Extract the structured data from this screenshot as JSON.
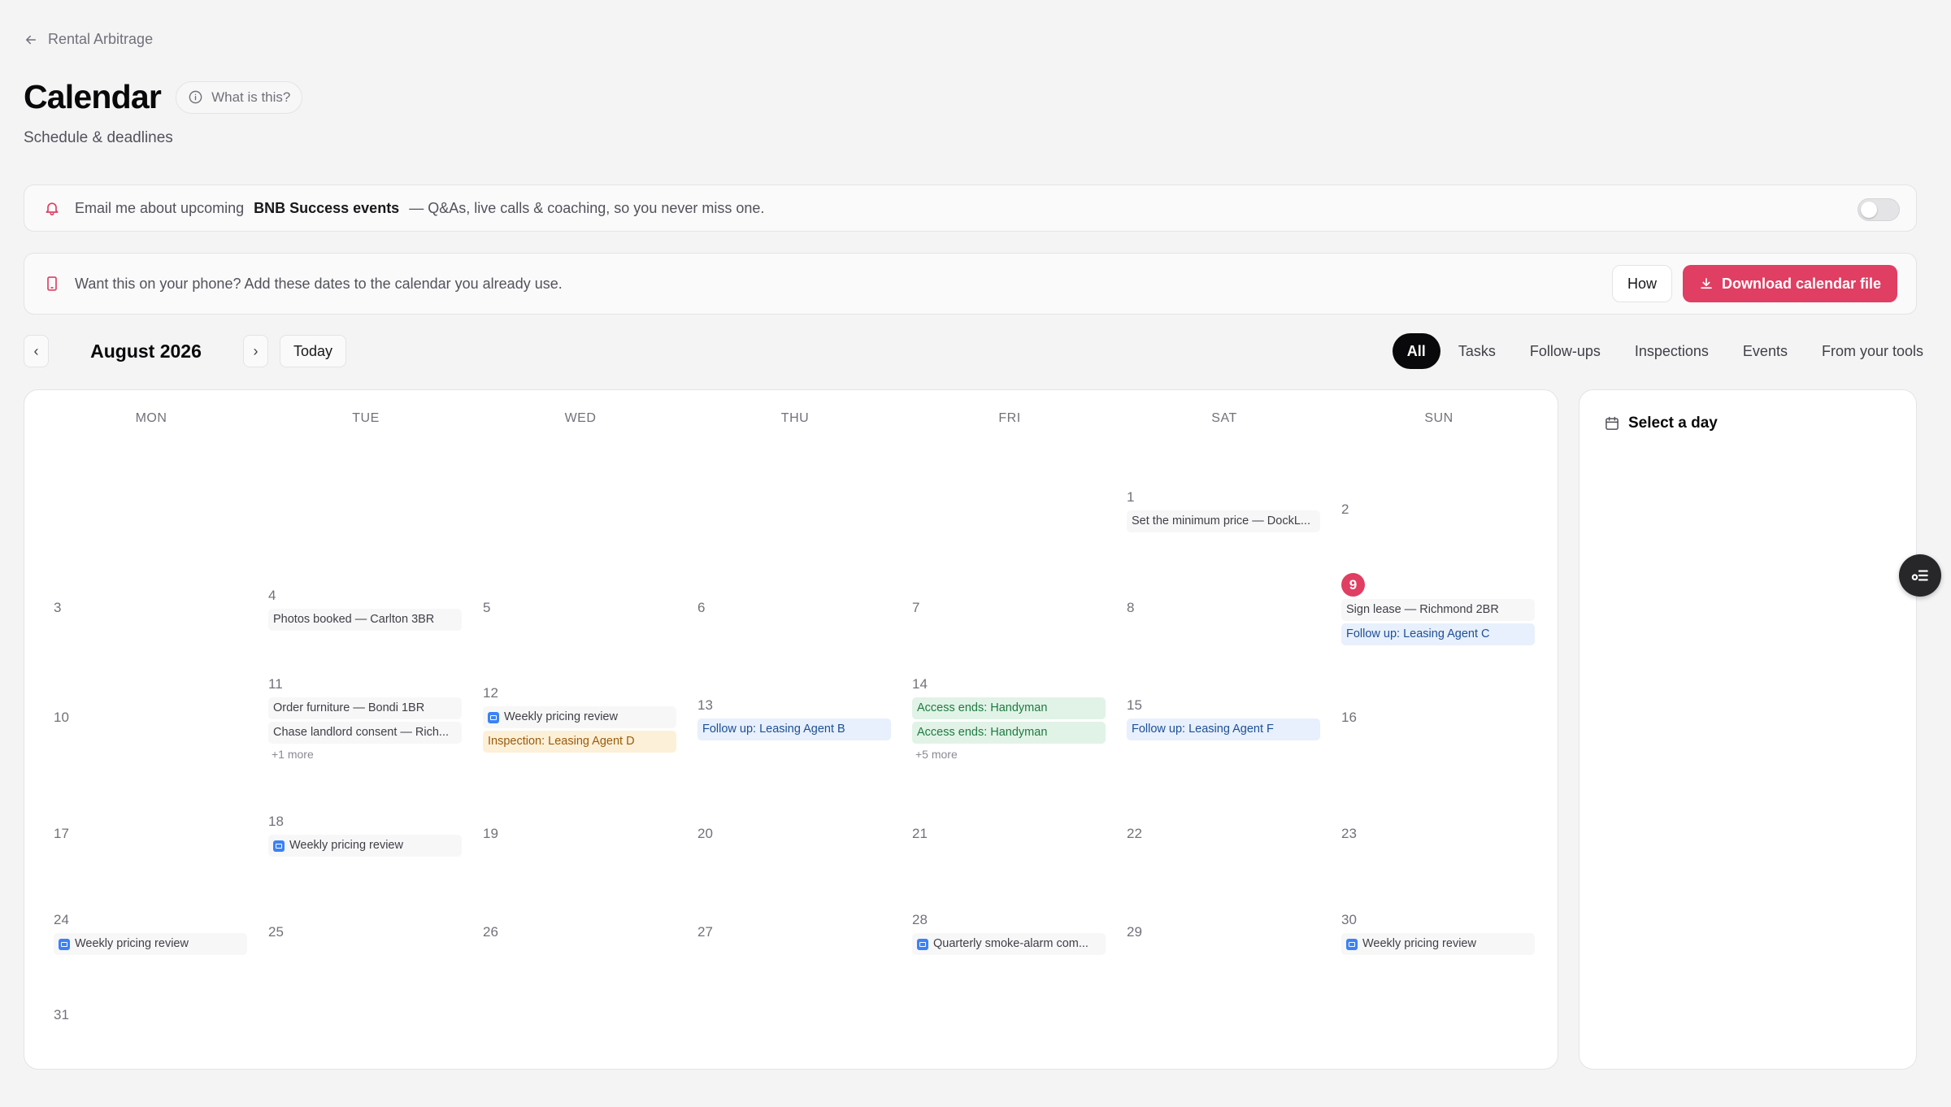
{
  "breadcrumb": {
    "label": "Rental Arbitrage"
  },
  "header": {
    "title": "Calendar",
    "help_label": "What is this?",
    "subtitle": "Schedule & deadlines"
  },
  "email_banner": {
    "prefix": "Email me about upcoming",
    "emphasis": "BNB Success events",
    "suffix": "— Q&As, live calls & coaching, so you never miss one.",
    "toggle_on": false
  },
  "phone_banner": {
    "text": "Want this on your phone? Add these dates to the calendar you already use.",
    "how_label": "How",
    "download_label": "Download calendar file"
  },
  "navigation": {
    "prev": "‹",
    "next": "›",
    "month": "August 2026",
    "today_label": "Today"
  },
  "filters": [
    {
      "label": "All",
      "active": true
    },
    {
      "label": "Tasks",
      "active": false
    },
    {
      "label": "Follow-ups",
      "active": false
    },
    {
      "label": "Inspections",
      "active": false
    },
    {
      "label": "Events",
      "active": false
    },
    {
      "label": "From your tools",
      "active": false
    }
  ],
  "weekdays": [
    "MON",
    "TUE",
    "WED",
    "THU",
    "FRI",
    "SAT",
    "SUN"
  ],
  "today": 9,
  "days": [
    {
      "n": "1",
      "events": [
        {
          "type": "task",
          "label": "Set the minimum price — DockL..."
        }
      ]
    },
    {
      "n": "2",
      "events": []
    },
    {
      "n": "3",
      "events": []
    },
    {
      "n": "4",
      "events": [
        {
          "type": "task",
          "label": "Photos booked — Carlton 3BR"
        }
      ]
    },
    {
      "n": "5",
      "events": []
    },
    {
      "n": "6",
      "events": []
    },
    {
      "n": "7",
      "events": []
    },
    {
      "n": "8",
      "events": []
    },
    {
      "n": "9",
      "events": [
        {
          "type": "task",
          "label": "Sign lease — Richmond 2BR"
        },
        {
          "type": "follow",
          "label": "Follow up: Leasing Agent C"
        }
      ]
    },
    {
      "n": "10",
      "events": []
    },
    {
      "n": "11",
      "events": [
        {
          "type": "task",
          "label": "Order furniture — Bondi 1BR"
        },
        {
          "type": "task",
          "label": "Chase landlord consent — Rich..."
        }
      ],
      "more": "+1 more"
    },
    {
      "n": "12",
      "events": [
        {
          "type": "tool",
          "label": "Weekly pricing review"
        },
        {
          "type": "insp",
          "label": "Inspection: Leasing Agent D"
        }
      ]
    },
    {
      "n": "13",
      "events": [
        {
          "type": "follow",
          "label": "Follow up: Leasing Agent B"
        }
      ]
    },
    {
      "n": "14",
      "events": [
        {
          "type": "access",
          "label": "Access ends: Handyman"
        },
        {
          "type": "access",
          "label": "Access ends: Handyman"
        }
      ],
      "more": "+5 more"
    },
    {
      "n": "15",
      "events": [
        {
          "type": "follow",
          "label": "Follow up: Leasing Agent F"
        }
      ]
    },
    {
      "n": "16",
      "events": []
    },
    {
      "n": "17",
      "events": []
    },
    {
      "n": "18",
      "events": [
        {
          "type": "tool",
          "label": "Weekly pricing review"
        }
      ]
    },
    {
      "n": "19",
      "events": []
    },
    {
      "n": "20",
      "events": []
    },
    {
      "n": "21",
      "events": []
    },
    {
      "n": "22",
      "events": []
    },
    {
      "n": "23",
      "events": []
    },
    {
      "n": "24",
      "events": [
        {
          "type": "tool",
          "label": "Weekly pricing review"
        }
      ]
    },
    {
      "n": "25",
      "events": []
    },
    {
      "n": "26",
      "events": []
    },
    {
      "n": "27",
      "events": []
    },
    {
      "n": "28",
      "events": [
        {
          "type": "tool",
          "label": "Quarterly smoke-alarm com..."
        }
      ]
    },
    {
      "n": "29",
      "events": []
    },
    {
      "n": "30",
      "events": [
        {
          "type": "tool",
          "label": "Weekly pricing review"
        }
      ]
    },
    {
      "n": "31",
      "events": []
    }
  ],
  "side_panel": {
    "title": "Select a day"
  },
  "colors": {
    "accent": "#e03e62",
    "follow_bg": "#e7f0fc",
    "inspection_bg": "#fdf0d8",
    "access_bg": "#e1f3e7",
    "tool_icon": "#3b82f6"
  }
}
